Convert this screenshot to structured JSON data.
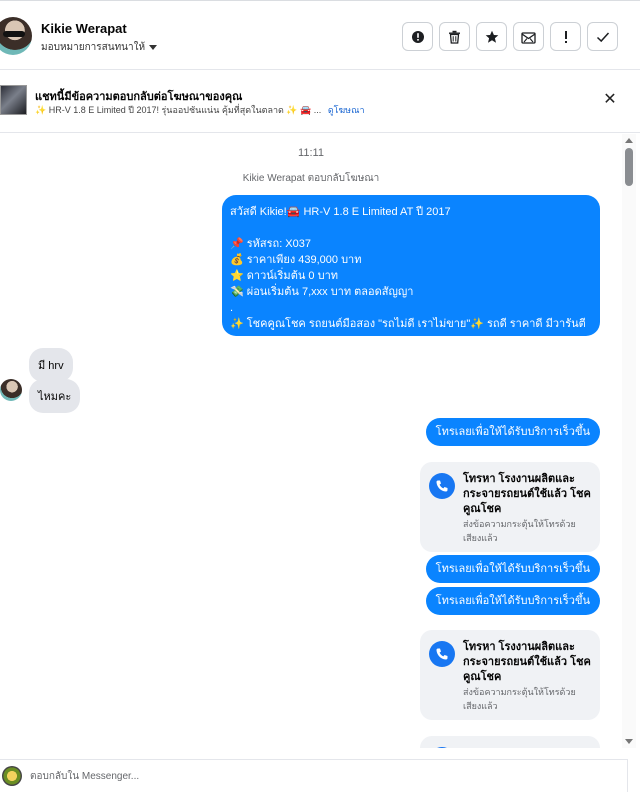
{
  "header": {
    "name": "Kikie Werapat",
    "assign_label": "มอบหมายการสนทนาให้",
    "icons": [
      "alert-circle-icon",
      "trash-icon",
      "star-icon",
      "mark-unread-icon",
      "exclamation-icon",
      "check-icon"
    ]
  },
  "banner": {
    "title": "แชทนี้มีข้อความตอบกลับต่อโฆษณาของคุณ",
    "subtitle": "✨ HR-V 1.8 E Limited ปี 2017! รุ่นออปชันแน่น คุ้มที่สุดในตลาด ✨ 🚘 ...",
    "link": "ดูโฆษณา"
  },
  "chat": {
    "time": "11:11",
    "system_line": "Kikie Werapat ตอบกลับโฆษณา",
    "ad_message": [
      "สวัสดี Kikie!🚘 HR-V 1.8 E Limited AT ปี 2017",
      "",
      "📌 รหัสรถ: X037",
      "💰 ราคาเพียง  439,000 บาท",
      "⭐ ดาวน์เริ่มต้น 0 บาท",
      "💸 ผ่อนเริ่มต้น 7,xxx บาท ตลอดสัญญา",
      ".",
      "✨ โชคคูณโชค รถยนต์มือสอง \"รถไม่ดี เราไม่ขาย\"✨ รถดี ราคาดี มีวารันตี"
    ],
    "incoming_1": "มี hrv",
    "incoming_2": "ไหมคะ",
    "cta": "โทรเลยเพื่อให้ได้รับบริการเร็วขึ้น",
    "call_card_title": "โทรหา โรงงานผลิตและกระจายรถยนต์ใช้แล้ว โชคคูณโชค",
    "call_card_sub": "ส่งข้อความกระตุ้นให้โทรด้วยเสียงแล้ว"
  },
  "composer": {
    "placeholder": "ตอบกลับใน Messenger..."
  },
  "colors": {
    "outgoing_bubble": "#0a84ff",
    "incoming_bubble": "#e4e6eb",
    "link": "#1a66d2",
    "call_icon_bg": "#1877f2"
  }
}
